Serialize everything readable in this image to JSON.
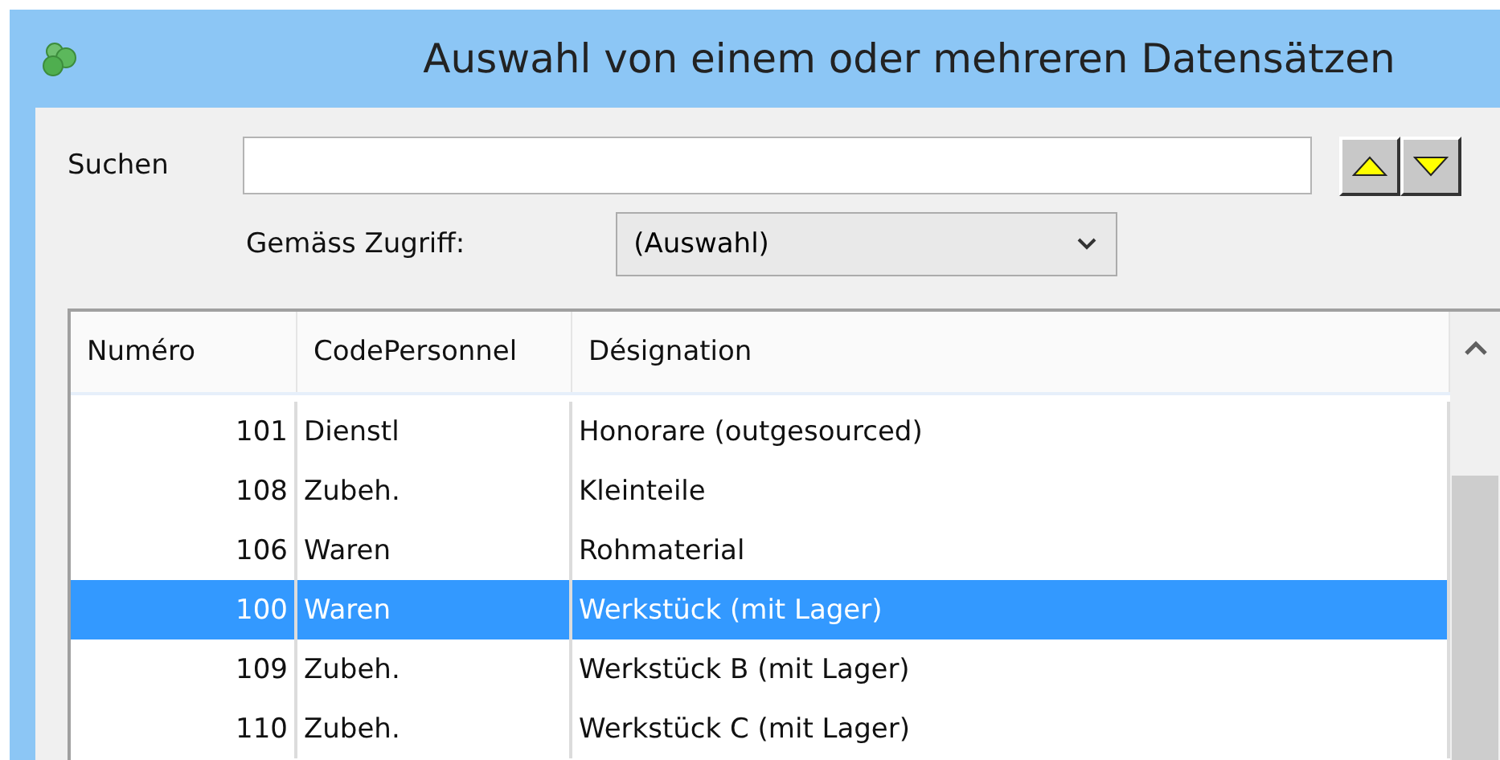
{
  "window": {
    "title": "Auswahl von einem oder mehreren Datensätzen"
  },
  "search": {
    "label": "Suchen"
  },
  "filter": {
    "label": "Gemäss Zugriff:",
    "value": "(Auswahl)"
  },
  "table": {
    "columns": [
      "Numéro",
      "CodePersonnel",
      "Désignation"
    ],
    "rows": [
      {
        "cells": [
          "101",
          "Dienstl",
          "Honorare (outgesourced)"
        ],
        "selected": false
      },
      {
        "cells": [
          "108",
          "Zubeh.",
          "Kleinteile"
        ],
        "selected": false
      },
      {
        "cells": [
          "106",
          "Waren",
          "Rohmaterial"
        ],
        "selected": false
      },
      {
        "cells": [
          "100",
          "Waren",
          "Werkstück (mit Lager)"
        ],
        "selected": true
      },
      {
        "cells": [
          "109",
          "Zubeh.",
          "Werkstück B (mit Lager)"
        ],
        "selected": false
      },
      {
        "cells": [
          "110",
          "Zubeh.",
          "Werkstück C (mit Lager)"
        ],
        "selected": false
      }
    ]
  }
}
